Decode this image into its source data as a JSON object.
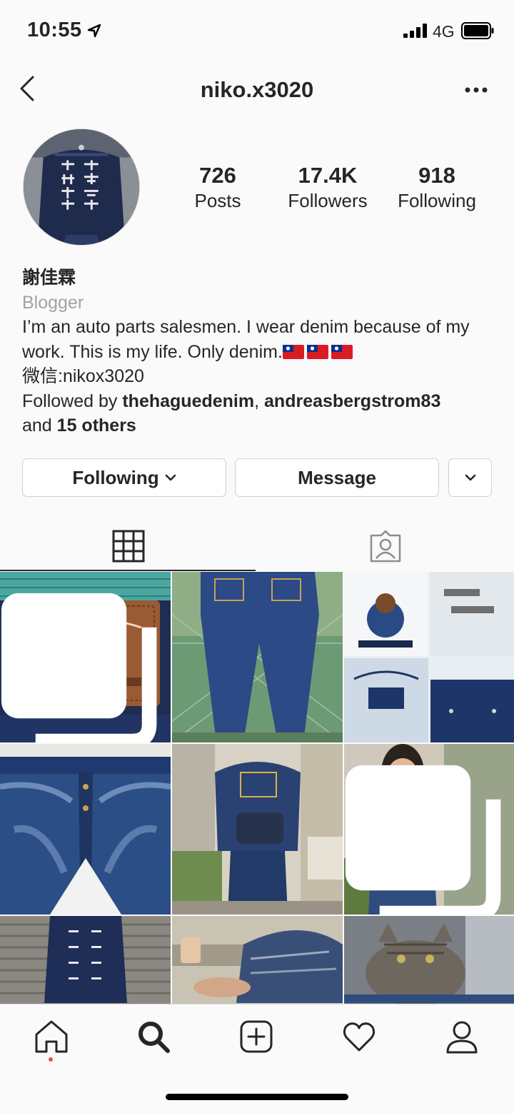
{
  "status_bar": {
    "time": "10:55",
    "network": "4G"
  },
  "header": {
    "username": "niko.x3020"
  },
  "stats": {
    "posts": {
      "value": "726",
      "label": "Posts"
    },
    "followers": {
      "value": "17.4K",
      "label": "Followers"
    },
    "following": {
      "value": "918",
      "label": "Following"
    }
  },
  "bio": {
    "name": "謝佳霖",
    "category": "Blogger",
    "description": "I’m an auto parts salesmen. I wear denim because of my work. This is my life. Only denim.",
    "wechat": "微信:nikox3020",
    "followed_by_prefix": "Followed by ",
    "followed_user_1": "thehaguedenim",
    "separator": ", ",
    "followed_user_2": "andreasbergstrom83",
    "and_text": "and ",
    "others": "15 others"
  },
  "actions": {
    "following_label": "Following",
    "message_label": "Message"
  },
  "tabs": [
    "grid-icon",
    "tagged-icon"
  ],
  "posts": [
    {
      "desc": "studio-dartisan-leather-patch",
      "multi": true
    },
    {
      "desc": "jeans-back-view",
      "multi": false
    },
    {
      "desc": "printed-tshirts",
      "multi": false
    },
    {
      "desc": "faded-jeans-front",
      "multi": false
    },
    {
      "desc": "denim-jacket-back",
      "multi": false
    },
    {
      "desc": "denim-dress",
      "multi": true
    },
    {
      "desc": "jacket-on-shutter",
      "multi": false
    },
    {
      "desc": "denim-arm",
      "multi": false
    },
    {
      "desc": "tabby-cat",
      "multi": false
    }
  ],
  "colors": {
    "text": "#262626",
    "secondary": "#a3a3a3",
    "border": "#dbdbdb",
    "notification_dot": "#ed4956",
    "flag_red": "#d91c22",
    "flag_blue": "#0c2f8e"
  },
  "bottom_nav": [
    "home-icon",
    "search-icon",
    "new-post-icon",
    "activity-heart-icon",
    "profile-icon"
  ]
}
